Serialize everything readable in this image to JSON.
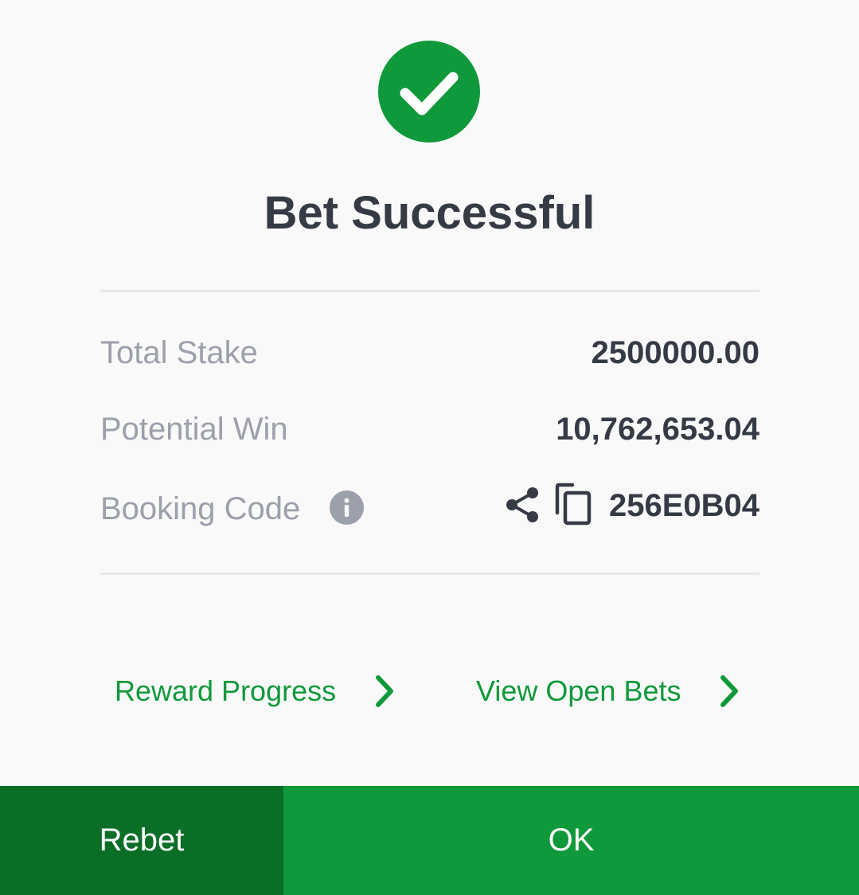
{
  "header": {
    "title": "Bet Successful",
    "status_icon": "check-circle-icon",
    "accent_color": "#10993a"
  },
  "details": {
    "total_stake_label": "Total Stake",
    "total_stake_value": "2500000.00",
    "potential_win_label": "Potential Win",
    "potential_win_value": "10,762,653.04",
    "booking_code_label": "Booking Code",
    "booking_code_value": "256E0B04",
    "icons": [
      "info-icon",
      "share-icon",
      "copy-icon"
    ]
  },
  "links": {
    "reward_progress": "Reward Progress",
    "view_open_bets": "View Open Bets"
  },
  "buttons": {
    "rebet": "Rebet",
    "ok": "OK",
    "rebet_color": "#0b6e26",
    "ok_color": "#10993a"
  }
}
